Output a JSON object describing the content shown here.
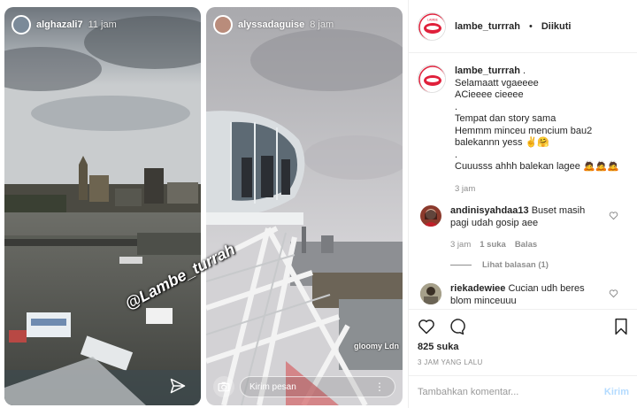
{
  "stories": [
    {
      "username": "alghazali7",
      "time": "11 jam",
      "watermark": "@Lambe_turrah"
    },
    {
      "username": "alyssadaguise",
      "time": "8 jam",
      "overlay_text": "gloomy Ldn",
      "reply_placeholder": "Kirim pesan"
    }
  ],
  "header": {
    "username": "lambe_turrrah",
    "separator": "•",
    "follow_status": "Diikuti"
  },
  "caption": {
    "username": "lambe_turrrah",
    "lines": [
      "Selamaatt vgaeeee",
      "ACieeee cieeee",
      ".",
      "Tempat dan story sama",
      "Hemmm minceu mencium bau2 balekannn yess ✌️🤗",
      ".",
      "Cuuusss ahhh balekan lagee 🙇🙇🙇"
    ],
    "time": "3 jam"
  },
  "comments": [
    {
      "username": "andinisyahdaa13",
      "text": "Buset masih pagi udah gosip aee",
      "time": "3 jam",
      "likes": "1 suka",
      "reply": "Balas",
      "view_replies": "Lihat balasan (1)"
    },
    {
      "username": "riekadewiee",
      "text": "Cucian udh beres blom minceuuu"
    }
  ],
  "actions": {
    "likes": "825 suka",
    "posted": "3 JAM YANG LALU"
  },
  "add_comment": {
    "placeholder": "Tambahkan komentar...",
    "post_label": "Kirim"
  },
  "colors": {
    "accent_red": "#e0203b",
    "link_disabled": "#b3dbff",
    "muted": "#8e8e8e"
  }
}
